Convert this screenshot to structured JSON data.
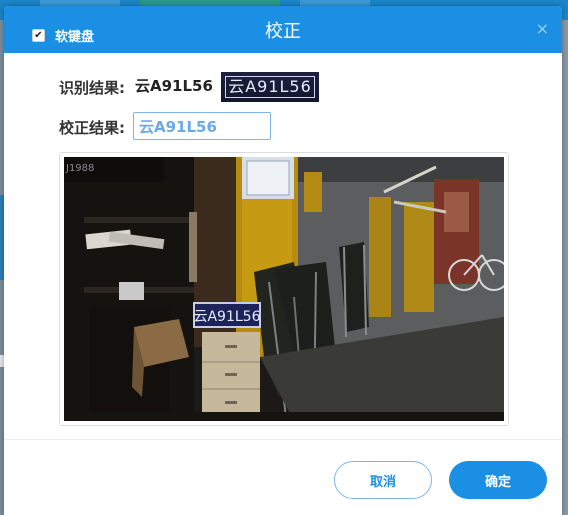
{
  "dialog": {
    "title": "校正",
    "soft_keyboard_label": "软键盘",
    "soft_keyboard_checked": true,
    "close_symbol": "×"
  },
  "recognition": {
    "label": "识别结果:",
    "value": "云A91L56",
    "plate_thumbnail_text": "云A91L56"
  },
  "correction": {
    "label": "校正结果:",
    "value": "云A91L56"
  },
  "photo": {
    "description_icon": "scene-photo",
    "wall_number": "J1988",
    "plate_text": "云A91L56"
  },
  "buttons": {
    "cancel": "取消",
    "confirm": "确定"
  },
  "colors": {
    "header": "#1a8fe3",
    "accent": "#1a8fe3",
    "input_text": "#6aaae6"
  }
}
